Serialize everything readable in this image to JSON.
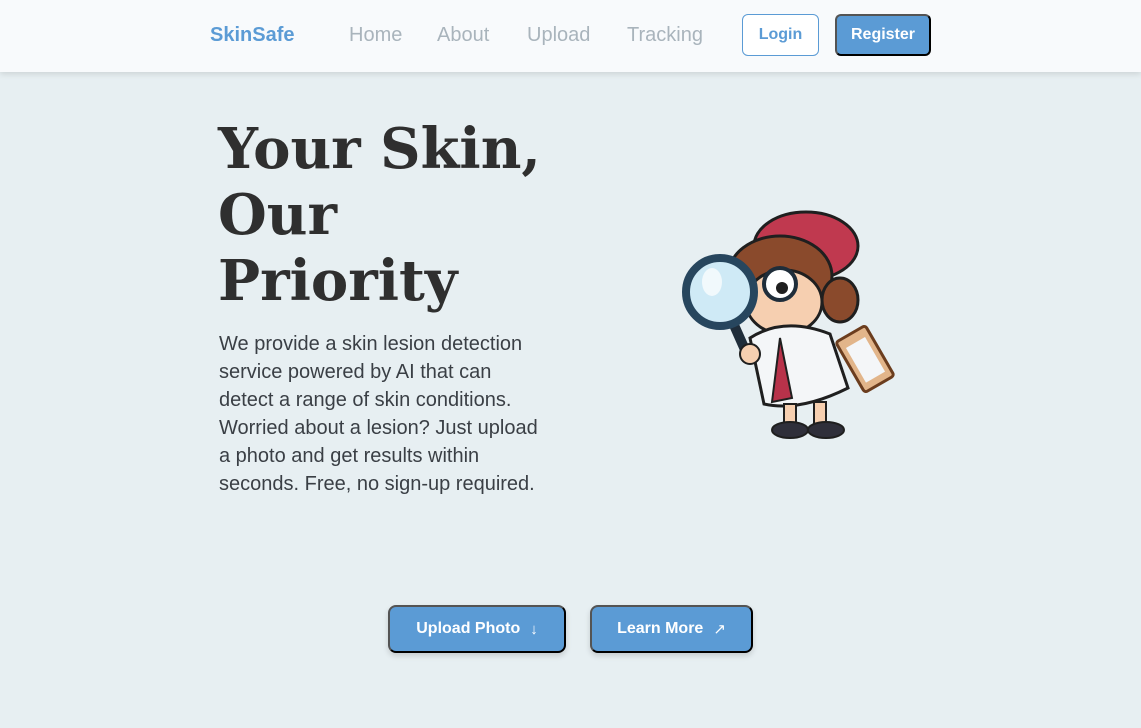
{
  "nav": {
    "brand": "SkinSafe",
    "links": [
      "Home",
      "About",
      "Upload",
      "Tracking"
    ],
    "login": "Login",
    "register": "Register"
  },
  "hero": {
    "title_lines": [
      "Your Skin,",
      "Our",
      "Priority"
    ],
    "description": "We provide a skin lesion detection service powered by AI that can detect a range of skin conditions. Worried about a lesion? Just upload a photo and get results within seconds. Free, no sign-up required."
  },
  "actions": {
    "upload": {
      "label": "Upload Photo",
      "icon": "arrow-down-icon",
      "glyph": "↓"
    },
    "learn": {
      "label": "Learn More",
      "icon": "arrow-up-right-icon",
      "glyph": "↗"
    }
  },
  "colors": {
    "accent": "#5b9bd5",
    "background": "#e7eff2",
    "nav_background": "#f8fafc",
    "nav_link": "#a9b4bc",
    "title": "#2f2f2f"
  }
}
